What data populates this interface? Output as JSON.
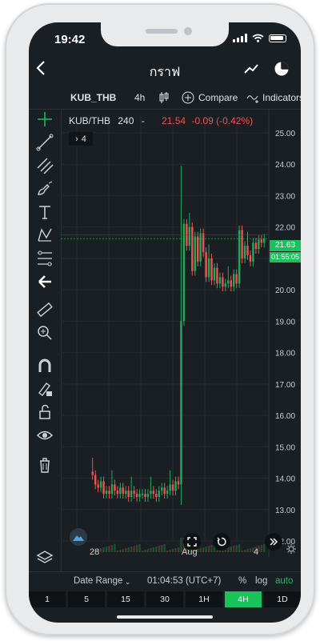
{
  "status": {
    "time": "19:42"
  },
  "header": {
    "title": "กราฟ",
    "back_icon": "back-arrow-icon",
    "line_icon": "line-chart-icon",
    "pie_icon": "pie-chart-icon"
  },
  "toolbar": {
    "symbol": "KUB_THB",
    "interval": "4h",
    "compare_label": "Compare",
    "indicators_label": "Indicators"
  },
  "legend": {
    "pair": "KUB/THB",
    "interval": "240",
    "dash": "-",
    "value": "21.54",
    "change": "-0.09 (-0.42%)",
    "collapse_count": "4"
  },
  "price_axis": {
    "labels": [
      "25.00",
      "24.00",
      "23.00",
      "22.00",
      "21.00",
      "20.00",
      "19.00",
      "18.00",
      "17.00",
      "16.00",
      "15.00",
      "14.00",
      "13.00",
      "12.00"
    ],
    "last_price": "21.63",
    "countdown": "01:55:05"
  },
  "time_axis": {
    "labels": [
      "28",
      "Aug",
      "4"
    ]
  },
  "colors": {
    "up": "#26a65b",
    "down": "#ef5350",
    "accent": "#19c25b",
    "background": "#1a1f23"
  },
  "chart_data": {
    "type": "candlestick",
    "symbol": "KUB/THB",
    "ylim": [
      12.0,
      25.0
    ],
    "candles_close": [
      14.1,
      13.8,
      13.7,
      13.9,
      13.5,
      13.6,
      13.5,
      13.8,
      13.6,
      13.5,
      13.7,
      13.5,
      13.6,
      13.4,
      13.6,
      13.5,
      13.4,
      13.5,
      13.5,
      13.4,
      13.5,
      13.6,
      13.5,
      13.4,
      13.6,
      13.7,
      13.5,
      13.6,
      13.8,
      13.6,
      13.9,
      13.8,
      19.0,
      22.1,
      21.4,
      22.0,
      20.6,
      21.7,
      20.9,
      21.8,
      21.2,
      20.4,
      21.0,
      20.3,
      20.7,
      20.2,
      20.4,
      20.1,
      20.2,
      20.3,
      20.1,
      20.5,
      20.2,
      21.9,
      21.0,
      21.4,
      21.1,
      20.9,
      21.5,
      21.3,
      21.6,
      21.5,
      21.63
    ],
    "last_close": 21.63
  },
  "bottom": {
    "date_range": "Date Range",
    "time": "01:04:53 (UTC+7)",
    "percent": "%",
    "log": "log",
    "auto": "auto"
  },
  "timeframes": [
    "1",
    "5",
    "15",
    "30",
    "1H",
    "4H",
    "1D"
  ],
  "active_timeframe": "4H"
}
